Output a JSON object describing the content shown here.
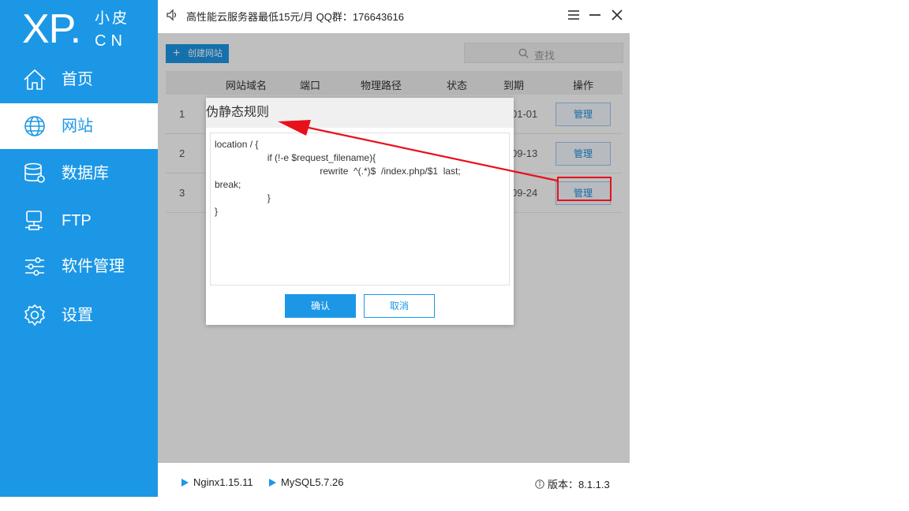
{
  "logo": {
    "main": "XP.",
    "top": "小皮",
    "bottom": "CN"
  },
  "sidebar": {
    "items": [
      {
        "label": "首页",
        "icon": "home-icon",
        "active": false
      },
      {
        "label": "网站",
        "icon": "globe-icon",
        "active": true
      },
      {
        "label": "数据库",
        "icon": "database-icon",
        "active": false
      },
      {
        "label": "FTP",
        "icon": "server-icon",
        "active": false
      },
      {
        "label": "软件管理",
        "icon": "sliders-icon",
        "active": false
      },
      {
        "label": "设置",
        "icon": "gear-icon",
        "active": false
      }
    ]
  },
  "header": {
    "notice": "高性能云服务器最低15元/月   QQ群：176643616",
    "icons": [
      "speaker-icon",
      "menu-icon",
      "minimize-icon",
      "close-icon"
    ]
  },
  "toolbar": {
    "create_label": "创建网站",
    "search_label": "查找"
  },
  "table": {
    "headers": [
      "网站域名",
      "端口",
      "物理路径",
      "状态",
      "到期",
      "操作"
    ],
    "rows": [
      {
        "index": "1",
        "date": "01-01",
        "action": "管理"
      },
      {
        "index": "2",
        "date": "09-13",
        "action": "管理"
      },
      {
        "index": "3",
        "date": "09-24",
        "action": "管理"
      }
    ]
  },
  "modal": {
    "title": "伪静态规则",
    "content": "location / {\n                    if (!-e $request_filename){\n                                        rewrite  ^(.*)$  /index.php/$1  last;\nbreak;\n                    }\n}",
    "ok_label": "确认",
    "cancel_label": "取消"
  },
  "footer": {
    "nginx": "Nginx1.15.11",
    "mysql": "MySQL5.7.26",
    "version": "版本：8.1.1.3"
  },
  "colors": {
    "accent": "#1c97e6",
    "annotation": "#e8101b"
  }
}
